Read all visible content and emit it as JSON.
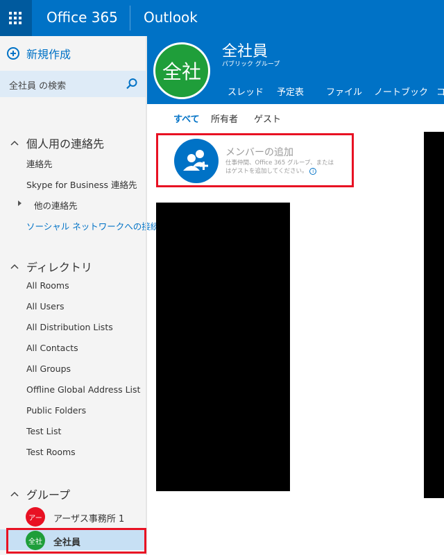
{
  "app": {
    "brand": "Office 365",
    "app_name": "Outlook"
  },
  "sidebar": {
    "new_label": "新規作成",
    "search_placeholder": "全社員 の検索",
    "personal": {
      "title": "個人用の連絡先",
      "items": [
        "連絡先",
        "Skype for Business 連絡先",
        "他の連絡先",
        "ソーシャル ネットワークへの接続"
      ]
    },
    "directory": {
      "title": "ディレクトリ",
      "items": [
        "All Rooms",
        "All Users",
        "All Distribution Lists",
        "All Contacts",
        "All Groups",
        "Offline Global Address List",
        "Public Folders",
        "Test List",
        "Test Rooms"
      ]
    },
    "groups": {
      "title": "グループ",
      "items": [
        {
          "avatar": "アー",
          "name": "アーザス事務所 1",
          "color": "#e81123"
        },
        {
          "avatar": "全社",
          "name": "全社員",
          "color": "#1f9e3a"
        }
      ]
    }
  },
  "group": {
    "avatar": "全社",
    "name": "全社員",
    "type": "パブリック グループ",
    "tabs": [
      "スレッド",
      "予定表",
      "ファイル",
      "ノートブック",
      "コ"
    ],
    "subtabs": [
      "すべて",
      "所有者",
      "ゲスト"
    ]
  },
  "add_member": {
    "title": "メンバーの追加",
    "description": "仕事仲間、Office 365 グループ、または\nはゲストを追加してください。",
    "info_glyph": "i"
  },
  "colors": {
    "accent": "#0072c6",
    "highlight": "#e81123",
    "group_green": "#1f9e3a"
  }
}
